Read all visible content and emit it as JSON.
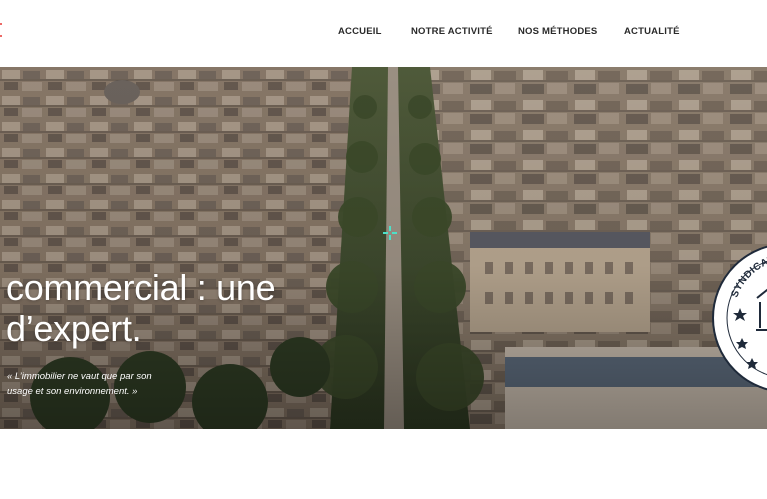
{
  "header": {
    "logo_accent_color": "#e53935",
    "nav": [
      {
        "label": "ACCUEIL"
      },
      {
        "label": "NOTRE ACTIVITÉ"
      },
      {
        "label": "NOS MÉTHODES"
      },
      {
        "label": "ACTUALITÉ"
      }
    ]
  },
  "hero": {
    "headline_line1": "commercial : une",
    "headline_line2": "d’expert.",
    "quote_line1": "« L’immobilier ne vaut que par son",
    "quote_line2": "usage et son environnement. »",
    "seal_text": "SYNDICAT NATION"
  }
}
